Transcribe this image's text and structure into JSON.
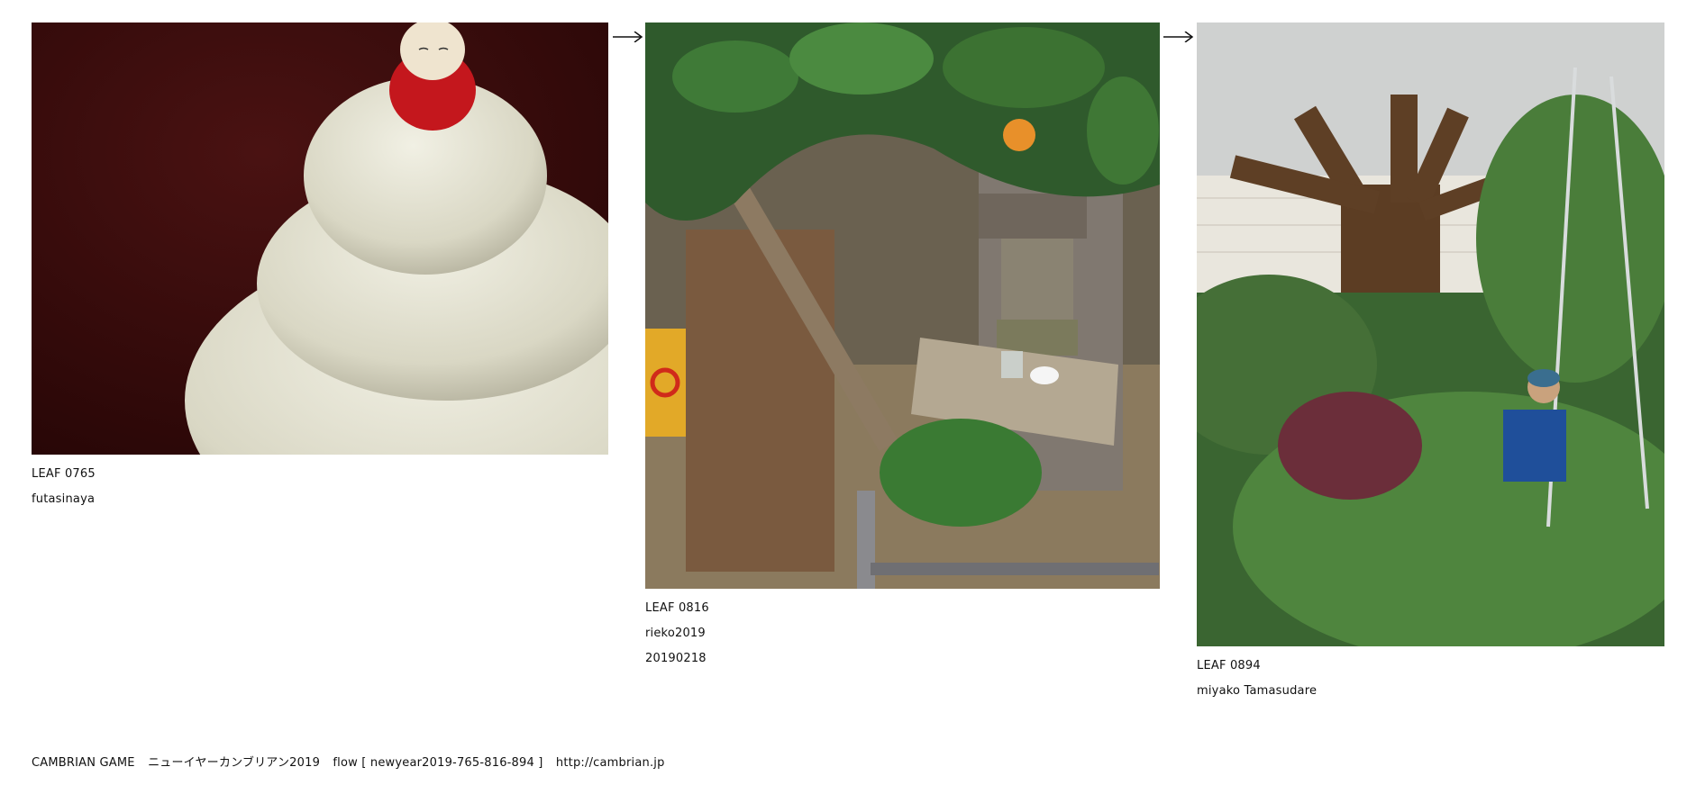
{
  "leaves": [
    {
      "id": "LEAF 0765",
      "author": "futasinaya",
      "date": ""
    },
    {
      "id": "LEAF 0816",
      "author": "rieko2019",
      "date": "20190218"
    },
    {
      "id": "LEAF 0894",
      "author": "miyako Tamasudare",
      "date": ""
    }
  ],
  "arrows": {
    "icon": "right-arrow-icon"
  },
  "footer": {
    "game": "CAMBRIAN GAME",
    "title": "ニューイヤーカンブリアン2019",
    "flow": "flow [ newyear2019-765-816-894 ]",
    "url": "http://cambrian.jp"
  }
}
